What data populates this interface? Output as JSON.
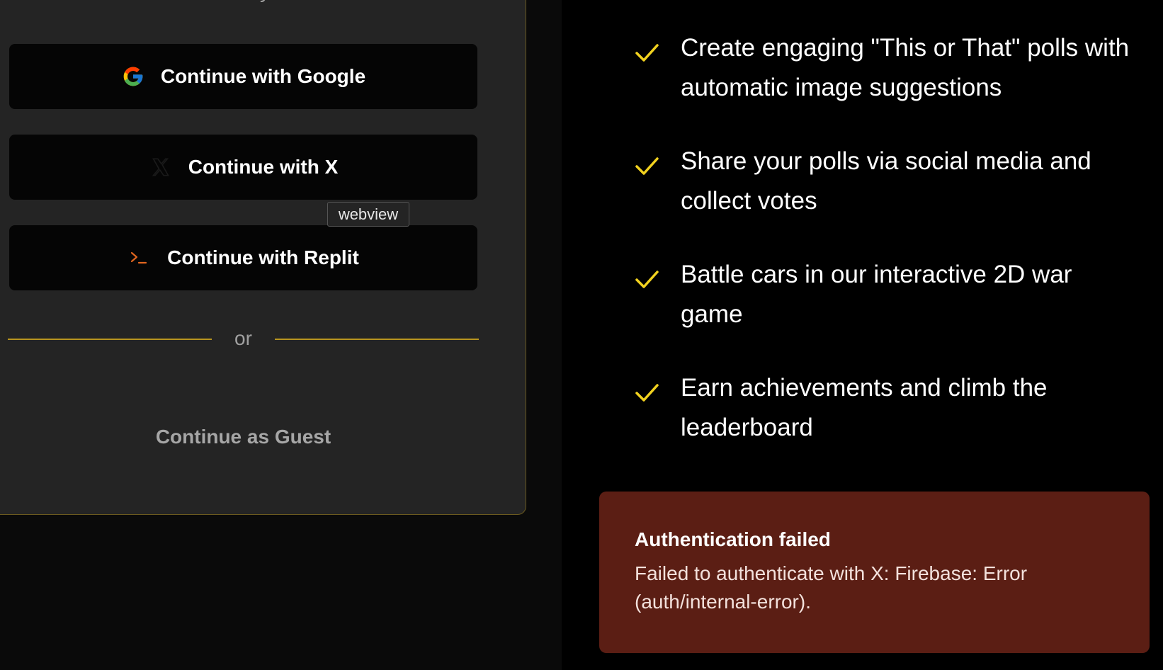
{
  "auth": {
    "subtitle": "easily",
    "buttons": {
      "google": "Continue with Google",
      "x": "Continue with X",
      "replit": "Continue with Replit"
    },
    "tooltip": "webview",
    "divider_text": "or",
    "guest": "Continue as Guest"
  },
  "features": [
    {
      "text": "Create engaging \"This or That\" polls with automatic image suggestions"
    },
    {
      "text": "Share your polls via social media and collect votes"
    },
    {
      "text": "Battle cars in our interactive 2D war game"
    },
    {
      "text": "Earn achievements and climb the leaderboard"
    }
  ],
  "toast": {
    "title": "Authentication failed",
    "description": "Failed to authenticate with X: Firebase: Error (auth/internal-error)."
  },
  "colors": {
    "accent": "#d4af37",
    "check": "#f2d21f",
    "toast_bg": "#5b1e14",
    "card_bg": "#242424"
  },
  "icons": {
    "google": "google-icon",
    "x": "x-logo-icon",
    "replit": "terminal-prompt-icon",
    "feature": "check-icon"
  }
}
